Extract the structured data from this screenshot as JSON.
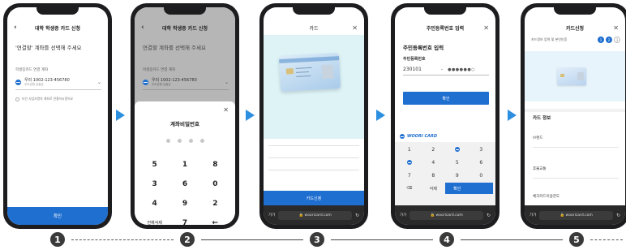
{
  "phone1": {
    "header": "대학 학생증 카드 신청",
    "title": "'연결할' 계좌를 선택해 주세요",
    "field_label": "학생증카드 연결 계좌",
    "account_number": "우리 1002-123-456780",
    "account_sub": "우리은행 입출금",
    "checkbox_label": "타인 사업자명의 계좌로 연결하시겠어요",
    "confirm": "확인"
  },
  "phone2": {
    "header": "대학 학생증 카드 신청",
    "title": "연결할 계좌를 선택해 주세요",
    "field_label": "학생증카드 연결 계좌",
    "account_number": "우리 1002-123-456780",
    "account_sub": "우리은행 입출금",
    "sheet_title": "계좌비밀번호",
    "keys": [
      "5",
      "1",
      "8",
      "3",
      "6",
      "0",
      "4",
      "9",
      "2",
      "전체삭제",
      "7",
      "←"
    ]
  },
  "phone3": {
    "header": "카드",
    "card_name": "홍길동",
    "button": "카드신청",
    "browser_aa": "가가",
    "browser_url": "🔒 wooricard.com",
    "browser_reload": "↻"
  },
  "phone4": {
    "header": "주민등록번호 입력",
    "title": "주민등록번호 입력",
    "field_label": "주민등록번호",
    "id_front": "230101",
    "id_dash": "-",
    "id_masked": "●●●●●●○",
    "confirm": "확인",
    "kb_brand": "WOORI CARD",
    "kb_keys": [
      "1",
      "2",
      "",
      "3",
      "",
      "4",
      "5",
      "6",
      "7",
      "8",
      "9",
      "0",
      "⌫",
      "삭제",
      "확인",
      ""
    ],
    "browser_aa": "가가",
    "browser_url": "🔒 wooricard.com",
    "browser_reload": "↻"
  },
  "phone5": {
    "header": "카드신청",
    "progress_label": "카드정보 입력 및 본인인증",
    "steps": [
      "1",
      "2",
      "3"
    ],
    "section": "카드 정보",
    "rows": [
      "브랜드",
      "후불교통",
      "체크카드이용한도"
    ],
    "browser_aa": "가가",
    "browser_url": "🔒 wooricard.com",
    "browser_reload": "↻"
  },
  "steps": [
    "1",
    "2",
    "3",
    "4",
    "5"
  ],
  "colors": {
    "accent_blue": "#1f6fd0",
    "arrow_blue": "#2d8fe0",
    "phone_frame": "#1d1d1f",
    "card_bg": "#ddf3f6"
  }
}
